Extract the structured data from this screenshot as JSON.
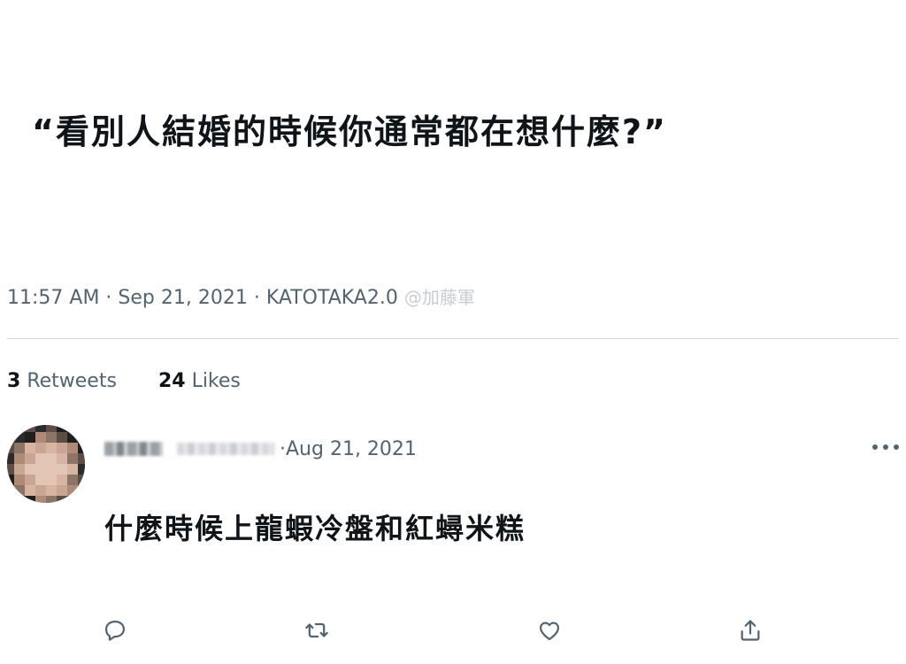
{
  "tweet": {
    "text": "“看別人結婚的時候你通常都在想什麼?”",
    "time": "11:57 AM",
    "separator": " · ",
    "date": "Sep 21, 2021",
    "source": "KATOTAKA2.0",
    "watermark": "@加藤軍"
  },
  "stats": {
    "retweets_count": "3",
    "retweets_label": "Retweets",
    "likes_count": "24",
    "likes_label": "Likes"
  },
  "reply": {
    "date_prefix": "· ",
    "date": "Aug 21, 2021",
    "text": "什麼時候上龍蝦冷盤和紅蟳米糕"
  },
  "icons": {
    "more": "more-horizontal-icon",
    "reply": "comment-icon",
    "retweet": "retweet-icon",
    "like": "heart-icon",
    "share": "share-icon"
  },
  "colors": {
    "text": "#0f1419",
    "secondary": "#536471",
    "divider": "#cfd9de"
  }
}
